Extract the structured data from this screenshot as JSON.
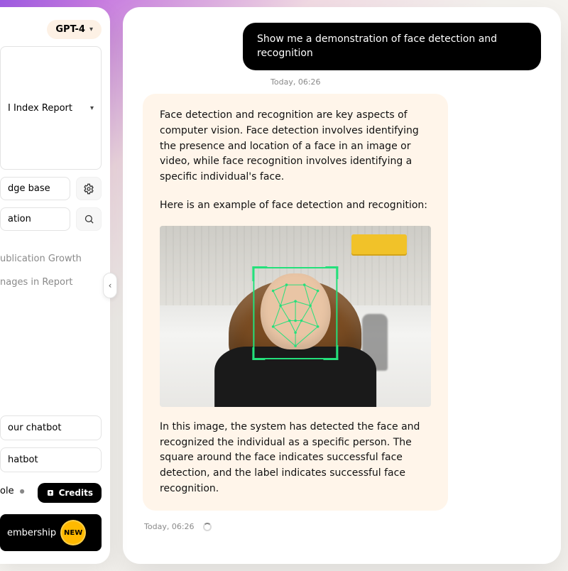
{
  "model_picker": {
    "label": "GPT-4"
  },
  "sidebar": {
    "report_select": "I Index Report",
    "kb_input": "dge base",
    "conv_input": "ation",
    "recent": [
      "ublication Growth",
      "nages in Report"
    ],
    "items": [
      "our chatbot",
      "hatbot",
      "ole"
    ],
    "credits_label": "Credits",
    "membership_label": "embership",
    "badge_new": "NEW"
  },
  "chat": {
    "user_message": "Show me a demonstration of face detection and recognition",
    "user_ts": "Today, 06:26",
    "assistant_p1": "Face detection and recognition are key aspects of computer vision. Face detection involves identifying the presence and location of a face in an image or video, while face recognition involves identifying a specific individual's face.",
    "assistant_p2": "Here is an example of face detection and recognition:",
    "assistant_p3": "In this image, the system has detected the face and recognized the individual as a specific person. The square around the face indicates successful face detection, and the label indicates successful face recognition.",
    "assistant_ts": "Today, 06:26"
  },
  "icons": {
    "chevron_down": "▾",
    "gear": "⚙",
    "search": "🔍",
    "collapse": "‹",
    "credits": "⬆",
    "info": "●"
  }
}
